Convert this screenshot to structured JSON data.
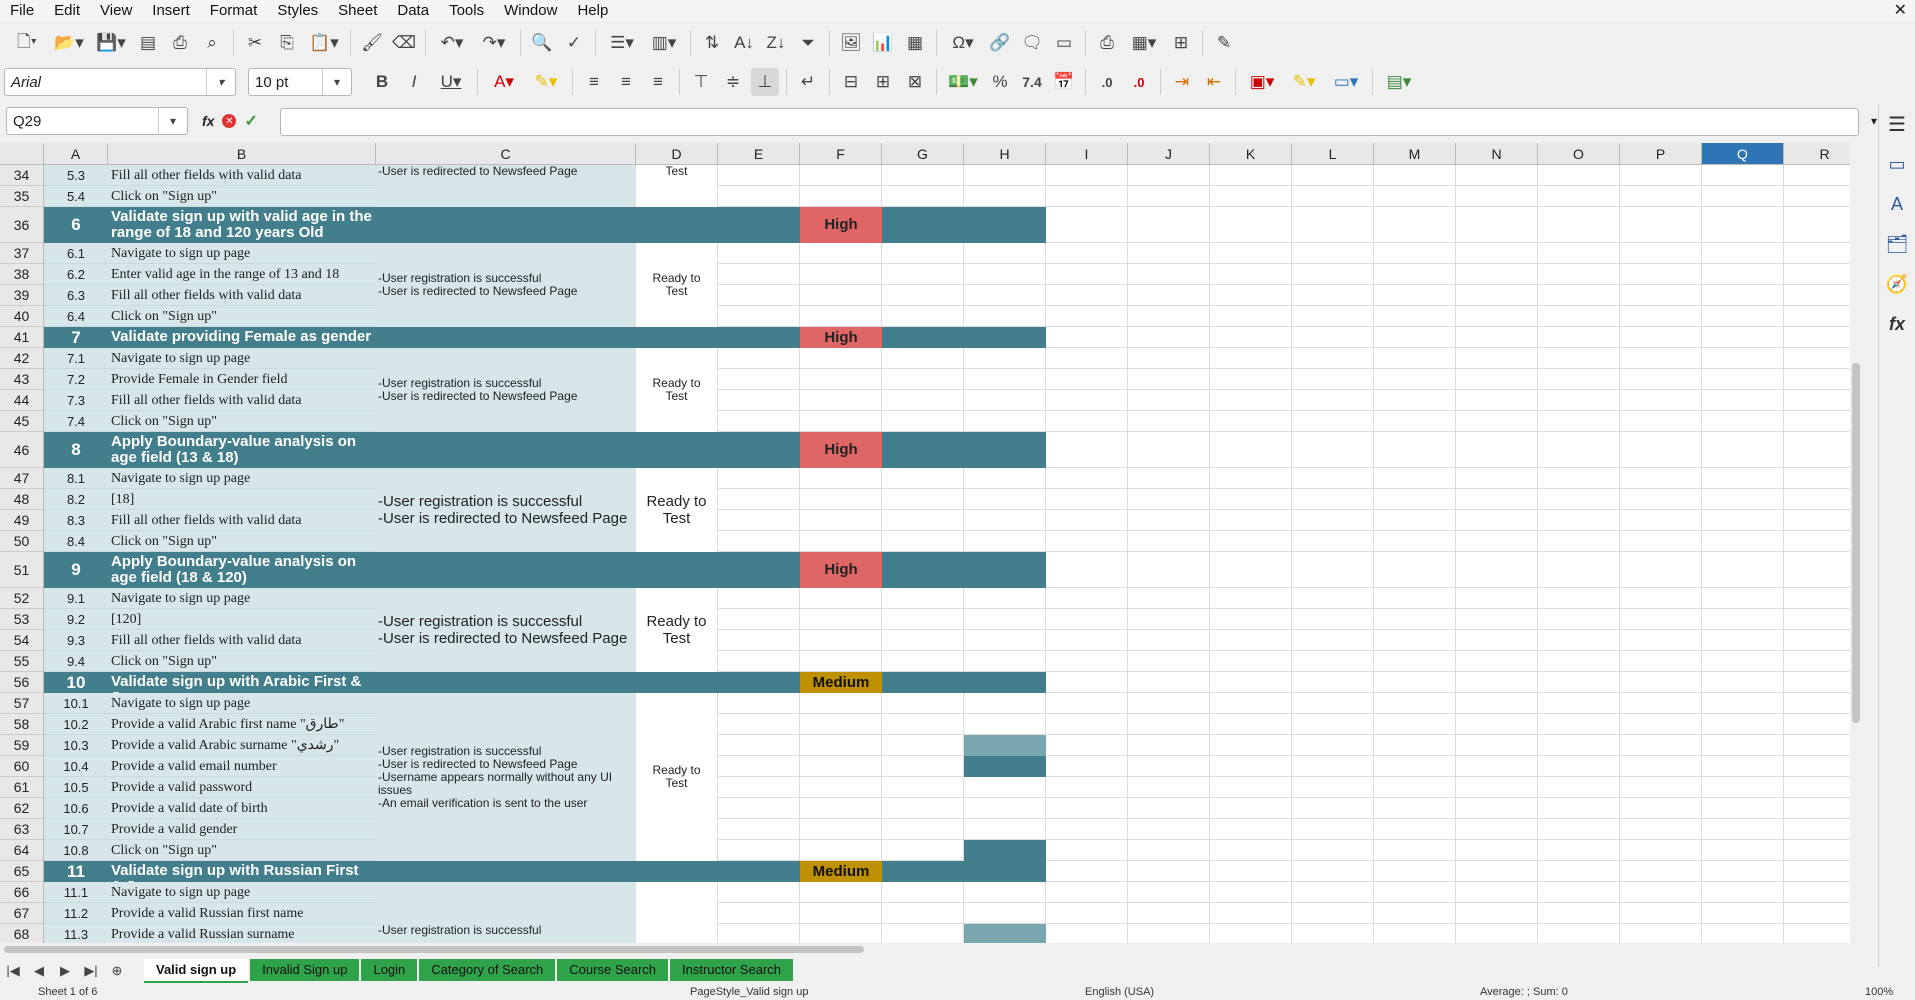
{
  "menu": [
    "File",
    "Edit",
    "View",
    "Insert",
    "Format",
    "Styles",
    "Sheet",
    "Data",
    "Tools",
    "Window",
    "Help"
  ],
  "font_name": "Arial",
  "font_size": "10 pt",
  "name_box": "Q29",
  "fx_label": "fx",
  "columns": [
    {
      "l": "A",
      "w": 64
    },
    {
      "l": "B",
      "w": 268
    },
    {
      "l": "C",
      "w": 260
    },
    {
      "l": "D",
      "w": 82
    },
    {
      "l": "E",
      "w": 82
    },
    {
      "l": "F",
      "w": 82
    },
    {
      "l": "G",
      "w": 82
    },
    {
      "l": "H",
      "w": 82
    },
    {
      "l": "I",
      "w": 82
    },
    {
      "l": "J",
      "w": 82
    },
    {
      "l": "K",
      "w": 82
    },
    {
      "l": "L",
      "w": 82
    },
    {
      "l": "M",
      "w": 82
    },
    {
      "l": "N",
      "w": 82
    },
    {
      "l": "O",
      "w": 82
    },
    {
      "l": "P",
      "w": 82
    },
    {
      "l": "Q",
      "w": 82
    },
    {
      "l": "R",
      "w": 82
    }
  ],
  "selected_column": "Q",
  "rows": [
    {
      "n": 34,
      "h": 21,
      "a": "5.3",
      "b": "Fill all other fields with valid data",
      "c": "-User is redirected to Newsfeed Page",
      "d": "Test"
    },
    {
      "n": 35,
      "h": 21,
      "a": "5.4",
      "b": "Click on \"Sign up\""
    },
    {
      "n": 36,
      "h": 36,
      "type": "header",
      "a": "6",
      "b": "Validate sign up with valid age in the range of 18 and 120 years Old",
      "f": "High"
    },
    {
      "n": 37,
      "h": 21,
      "a": "6.1",
      "b": "Navigate to sign up page"
    },
    {
      "n": 38,
      "h": 21,
      "a": "6.2",
      "b": "Enter valid age in the range of 13 and 18",
      "c": "-User registration is successful\n-User is redirected to Newsfeed Page",
      "d": "Ready to\nTest"
    },
    {
      "n": 39,
      "h": 21,
      "a": "6.3",
      "b": "Fill all other fields with valid data"
    },
    {
      "n": 40,
      "h": 21,
      "a": "6.4",
      "b": "Click on \"Sign up\""
    },
    {
      "n": 41,
      "h": 21,
      "type": "header",
      "a": "7",
      "b": "Validate providing Female as gender",
      "f": "High"
    },
    {
      "n": 42,
      "h": 21,
      "a": "7.1",
      "b": "Navigate to sign up page"
    },
    {
      "n": 43,
      "h": 21,
      "a": "7.2",
      "b": "Provide Female in Gender field",
      "c": "-User registration is successful\n-User is redirected to Newsfeed Page",
      "d": "Ready to\nTest"
    },
    {
      "n": 44,
      "h": 21,
      "a": "7.3",
      "b": "Fill all other fields with valid data"
    },
    {
      "n": 45,
      "h": 21,
      "a": "7.4",
      "b": "Click on \"Sign up\""
    },
    {
      "n": 46,
      "h": 36,
      "type": "header",
      "a": "8",
      "b": "Apply Boundary-value analysis on age field (13 & 18)",
      "f": "High"
    },
    {
      "n": 47,
      "h": 21,
      "a": "8.1",
      "b": "Navigate to sign up page"
    },
    {
      "n": 48,
      "h": 21,
      "a": "8.2",
      "b": "[18]",
      "c": "-User registration is successful\n-User is redirected to Newsfeed Page",
      "d": "Ready to\nTest"
    },
    {
      "n": 49,
      "h": 21,
      "a": "8.3",
      "b": "Fill all other fields with valid data"
    },
    {
      "n": 50,
      "h": 21,
      "a": "8.4",
      "b": "Click on \"Sign up\""
    },
    {
      "n": 51,
      "h": 36,
      "type": "header",
      "a": "9",
      "b": "Apply Boundary-value analysis on age field (18 & 120)",
      "f": "High"
    },
    {
      "n": 52,
      "h": 21,
      "a": "9.1",
      "b": "Navigate to sign up page"
    },
    {
      "n": 53,
      "h": 21,
      "a": "9.2",
      "b": "[120]",
      "c": "-User registration is successful\n-User is redirected to Newsfeed Page",
      "d": "Ready to\nTest"
    },
    {
      "n": 54,
      "h": 21,
      "a": "9.3",
      "b": "Fill all other fields with valid data"
    },
    {
      "n": 55,
      "h": 21,
      "a": "9.4",
      "b": "Click on \"Sign up\""
    },
    {
      "n": 56,
      "h": 21,
      "type": "header",
      "a": "10",
      "b": "Validate sign up with Arabic First & Surname",
      "f": "Medium"
    },
    {
      "n": 57,
      "h": 21,
      "a": "10.1",
      "b": "Navigate to sign up page"
    },
    {
      "n": 58,
      "h": 21,
      "a": "10.2",
      "b": "Provide a valid Arabic first name \"طارق\""
    },
    {
      "n": 59,
      "h": 21,
      "a": "10.3",
      "b": "Provide a valid Arabic surname \"رشدي\"",
      "c": "-User registration is successful\n-User is redirected to Newsfeed Page\n-Username appears normally without any UI\nissues\n-An email verification is sent to the user",
      "d": "Ready to\nTest",
      "h_fill": "#7aa6b0"
    },
    {
      "n": 60,
      "h": 21,
      "a": "10.4",
      "b": "Provide a valid email number",
      "h_fill": "#437e8c"
    },
    {
      "n": 61,
      "h": 21,
      "a": "10.5",
      "b": "Provide a valid password"
    },
    {
      "n": 62,
      "h": 21,
      "a": "10.6",
      "b": "Provide a valid date of birth"
    },
    {
      "n": 63,
      "h": 21,
      "a": "10.7",
      "b": "Provide a valid gender"
    },
    {
      "n": 64,
      "h": 21,
      "a": "10.8",
      "b": "Click on \"Sign up\"",
      "h_fill": "#437e8c"
    },
    {
      "n": 65,
      "h": 21,
      "type": "header",
      "a": "11",
      "b": "Validate sign up with Russian First & Surname",
      "f": "Medium",
      "h_fill": "#437e8c"
    },
    {
      "n": 66,
      "h": 21,
      "a": "11.1",
      "b": "Navigate to sign up page"
    },
    {
      "n": 67,
      "h": 21,
      "a": "11.2",
      "b": "Provide a valid Russian first name"
    },
    {
      "n": 68,
      "h": 21,
      "a": "11.3",
      "b": "Provide a valid Russian surname",
      "c": "-User registration is successful",
      "h_fill": "#7aa6b0"
    }
  ],
  "merge_blocks": [
    {
      "c_row": 38,
      "d_row": 38,
      "start": 37,
      "end": 40
    },
    {
      "c_row": 43,
      "d_row": 43,
      "start": 42,
      "end": 45
    },
    {
      "c_row": 48,
      "d_row": 48,
      "start": 47,
      "end": 50
    },
    {
      "c_row": 53,
      "d_row": 53,
      "start": 52,
      "end": 55
    },
    {
      "c_row": 59,
      "d_row": 59,
      "start": 57,
      "end": 64
    }
  ],
  "tabs": [
    "Valid sign up",
    "Invalid Sign up",
    "Login",
    "Category of Search",
    "Course Search",
    "Instructor Search"
  ],
  "active_tab": "Valid sign up",
  "status": {
    "sheet": "Sheet 1 of 6",
    "page_style": "PageStyle_Valid sign up",
    "language": "English (USA)",
    "summary": "Average: ; Sum: 0",
    "zoom": "100%"
  },
  "colors": {
    "teal_header": "#437e8c",
    "light_teal": "#d7e6e9",
    "high": "#e06666",
    "medium": "#bf9000",
    "selected_col": "#2e75b6"
  }
}
